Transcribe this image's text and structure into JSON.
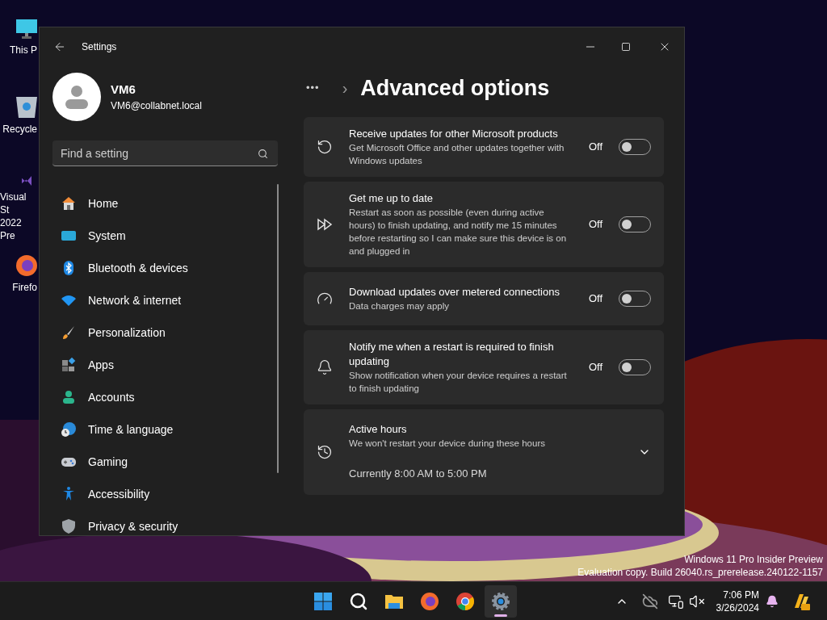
{
  "desktop_icons": [
    {
      "label": [
        "This P"
      ]
    },
    {
      "label": [
        "Recycle"
      ]
    },
    {
      "label": [
        "Visual St",
        "2022 Pre"
      ]
    },
    {
      "label": [
        "Firefo"
      ]
    }
  ],
  "window": {
    "title": "Settings"
  },
  "account": {
    "name": "VM6",
    "email": "VM6@collabnet.local"
  },
  "search": {
    "placeholder": "Find a setting"
  },
  "nav": [
    {
      "label": "Home",
      "selected": false
    },
    {
      "label": "System",
      "selected": false
    },
    {
      "label": "Bluetooth & devices",
      "selected": false
    },
    {
      "label": "Network & internet",
      "selected": false
    },
    {
      "label": "Personalization",
      "selected": false
    },
    {
      "label": "Apps",
      "selected": false
    },
    {
      "label": "Accounts",
      "selected": false
    },
    {
      "label": "Time & language",
      "selected": false
    },
    {
      "label": "Gaming",
      "selected": false
    },
    {
      "label": "Accessibility",
      "selected": false
    },
    {
      "label": "Privacy & security",
      "selected": false
    }
  ],
  "breadcrumb": {
    "more": "•••",
    "separator": "›",
    "title": "Advanced options"
  },
  "settings": [
    {
      "kind": "toggle",
      "title": "Receive updates for other Microsoft products",
      "description": "Get Microsoft Office and other updates together with Windows updates",
      "state_label": "Off",
      "on": false
    },
    {
      "kind": "toggle",
      "title": "Get me up to date",
      "description": "Restart as soon as possible (even during active hours) to finish updating, and notify me 15 minutes before restarting so I can make sure this device is on and plugged in",
      "state_label": "Off",
      "on": false
    },
    {
      "kind": "toggle",
      "title": "Download updates over metered connections",
      "description": "Data charges may apply",
      "state_label": "Off",
      "on": false
    },
    {
      "kind": "toggle",
      "title": "Notify me when a restart is required to finish updating",
      "description": "Show notification when your device requires a restart to finish updating",
      "state_label": "Off",
      "on": false
    },
    {
      "kind": "expander",
      "title": "Active hours",
      "description": "We won't restart your device during these hours",
      "value": "Currently 8:00 AM to 5:00 PM",
      "expanded": false
    }
  ],
  "watermark": [
    "Windows 11 Pro Insider Preview",
    "Evaluation copy. Build 26040.rs_prerelease.240122-1157"
  ],
  "taskbar": {
    "apps": [
      {
        "selected": false
      },
      {
        "selected": false
      },
      {
        "selected": false
      },
      {
        "selected": false
      },
      {
        "selected": false
      },
      {
        "selected": true
      }
    ],
    "time": "7:06 PM",
    "date": "3/26/2024"
  }
}
